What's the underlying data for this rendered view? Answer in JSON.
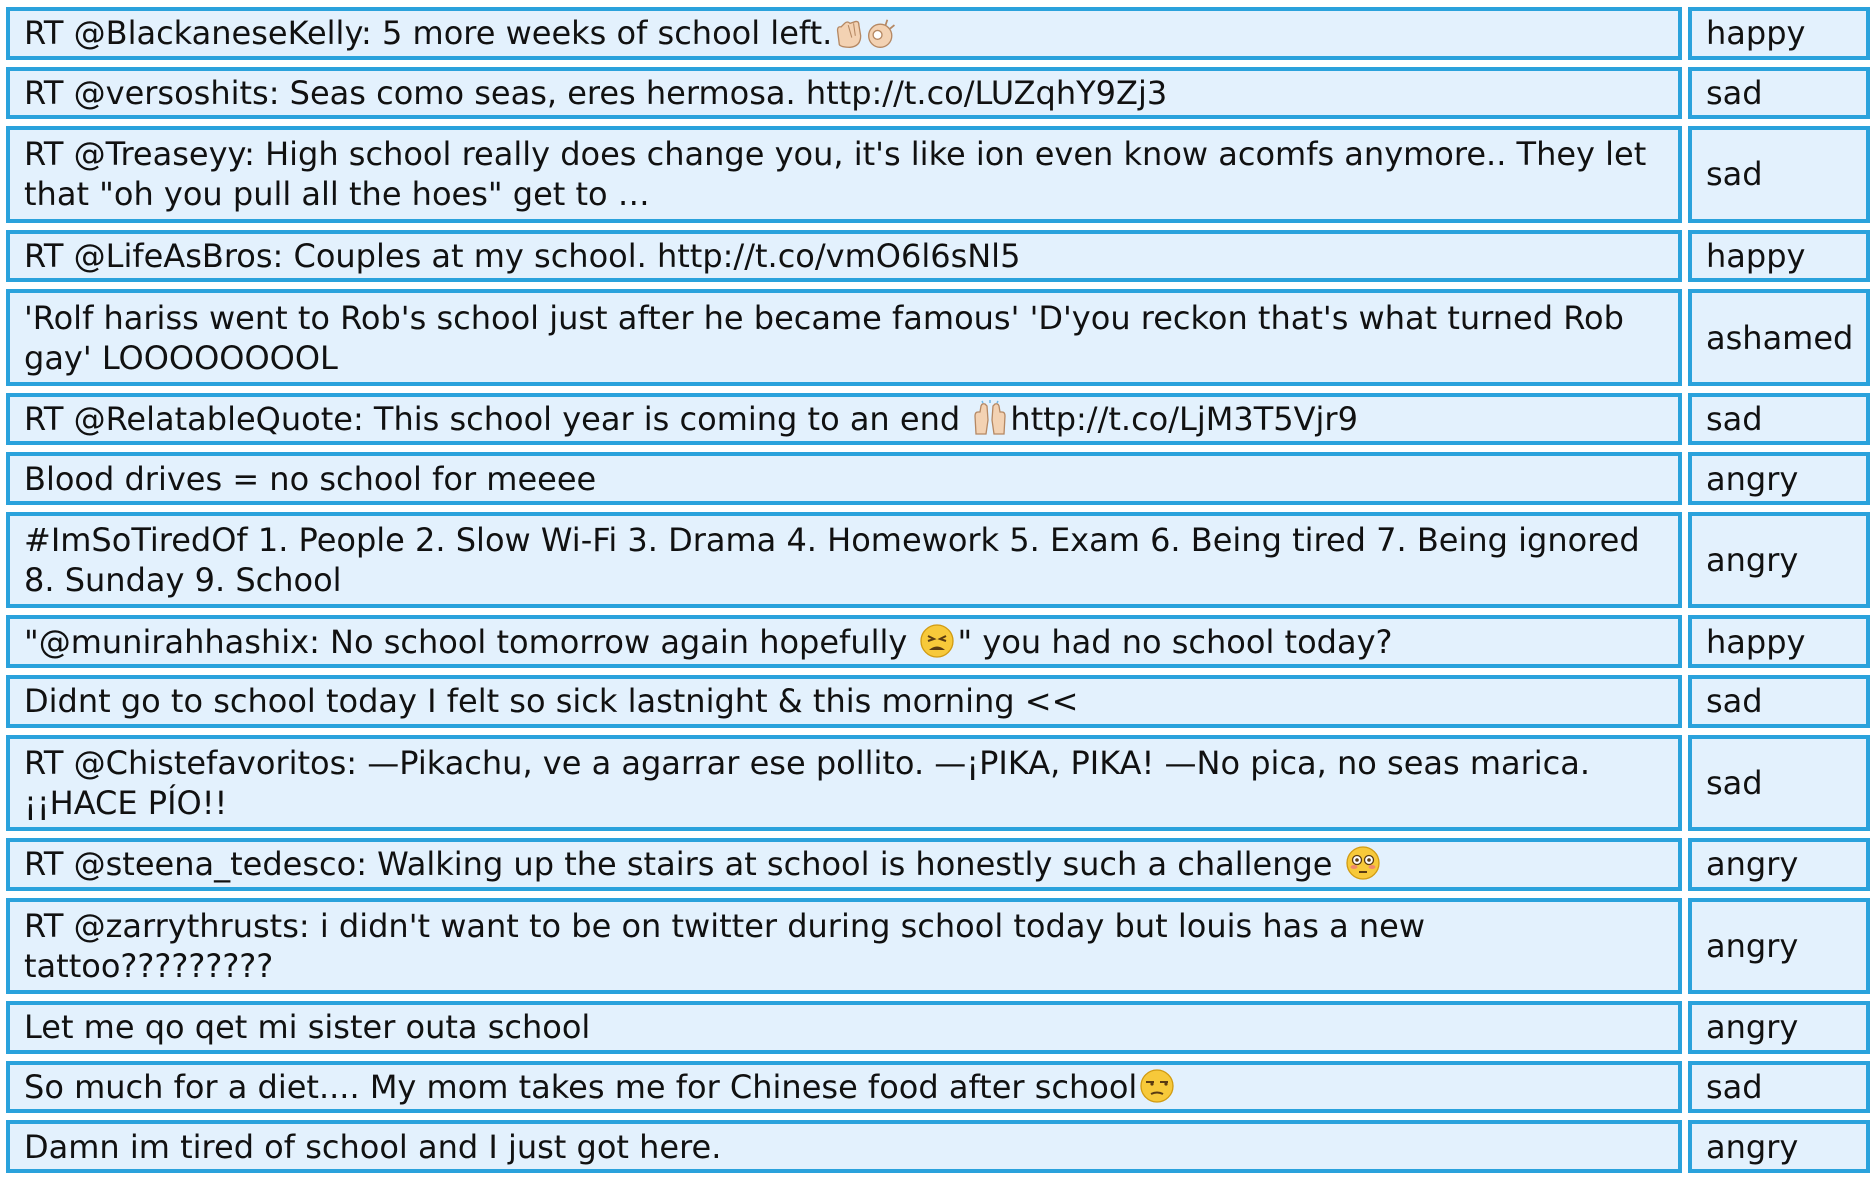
{
  "colors": {
    "cell_background": "#e3f1fd",
    "cell_border": "#2aa2dc",
    "text": "#111111"
  },
  "rows": [
    {
      "text_before": "RT @BlackaneseKelly: 5 more weeks of school left.",
      "emoji": "clapping-hands-ok-hand-emoji",
      "text_after": "",
      "label": "happy"
    },
    {
      "text_before": "RT @versoshits: Seas como seas, eres hermosa. http://t.co/LUZqhY9Zj3",
      "emoji": "",
      "text_after": "",
      "label": "sad"
    },
    {
      "text_before": "RT @Treaseyy: High school really does change you, it's like ion even know acomfs anymore.. They let that \"oh you pull all the hoes\" get to …",
      "emoji": "",
      "text_after": "",
      "label": "sad"
    },
    {
      "text_before": "RT @LifeAsBros: Couples at my school. http://t.co/vmO6l6sNl5",
      "emoji": "",
      "text_after": "",
      "label": "happy"
    },
    {
      "text_before": "'Rolf hariss went to Rob's school just after he became famous' 'D'you reckon that's what turned Rob gay' LOOOOOOOOL",
      "emoji": "",
      "text_after": "",
      "label": "ashamed"
    },
    {
      "text_before": "RT @RelatableQuote: This school year is coming to an end ",
      "emoji": "raising-hands-emoji",
      "text_after": "http://t.co/LjM3T5Vjr9",
      "label": "sad"
    },
    {
      "text_before": "Blood drives = no school for meeee",
      "emoji": "",
      "text_after": "",
      "label": "angry"
    },
    {
      "text_before": "#ImSoTiredOf 1. People 2. Slow Wi-Fi 3. Drama 4. Homework 5. Exam 6. Being tired 7. Being ignored 8. Sunday 9. School",
      "emoji": "",
      "text_after": "",
      "label": "angry"
    },
    {
      "text_before": "\"@munirahhashix: No school tomorrow again hopefully ",
      "emoji": "tired-face-emoji",
      "text_after": "\" you had no school today?",
      "label": "happy"
    },
    {
      "text_before": "Didnt go to school today I felt so sick lastnight & this morning <<",
      "emoji": "",
      "text_after": "",
      "label": "sad"
    },
    {
      "text_before": "RT @Chistefavoritos: —Pikachu, ve a agarrar ese pollito. —¡PIKA, PIKA! —No pica, no seas marica. ¡¡HACE PÍO!!",
      "emoji": "",
      "text_after": "",
      "label": "sad"
    },
    {
      "text_before": "RT @steena_tedesco: Walking up the stairs at school is honestly such a challenge ",
      "emoji": "flushed-face-emoji",
      "text_after": "",
      "label": "angry"
    },
    {
      "text_before": "RT @zarrythrusts: i didn't want to be on twitter during school today but louis has a new tattoo?????????",
      "emoji": "",
      "text_after": "",
      "label": "angry"
    },
    {
      "text_before": "Let me qo qet mi sister outa school",
      "emoji": "",
      "text_after": "",
      "label": "angry"
    },
    {
      "text_before": "So much for a diet.... My mom takes me for Chinese food after school",
      "emoji": "unamused-face-emoji",
      "text_after": "",
      "label": "sad"
    },
    {
      "text_before": "Damn im tired of school and I just got here.",
      "emoji": "",
      "text_after": "",
      "label": "angry"
    }
  ]
}
